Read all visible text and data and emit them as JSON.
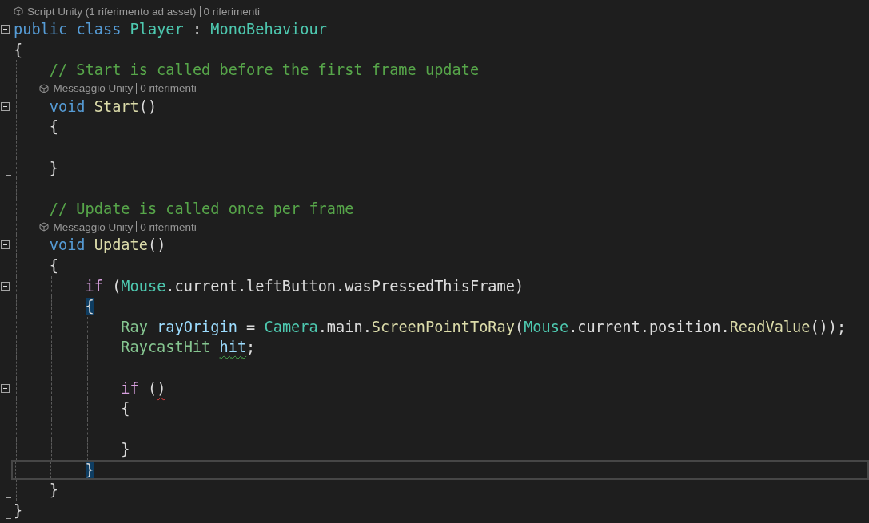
{
  "editor": {
    "lines": [
      {
        "kind": "codelens",
        "items": [
          "Script Unity (1 riferimento ad asset)",
          "0 riferimenti"
        ]
      },
      {
        "kind": "code",
        "expanded": true,
        "tokens": [
          {
            "text": "public",
            "kind": "keyword"
          },
          {
            "text": " class",
            "kind": "keyword"
          },
          {
            "text": " Player",
            "kind": "class"
          },
          {
            "text": " :"
          },
          {
            "text": " MonoBehaviour",
            "kind": "class"
          }
        ]
      },
      {
        "kind": "code",
        "tokens": [
          {
            "text": "{"
          }
        ]
      },
      {
        "kind": "code",
        "tokens": [
          {
            "text": "    // Start is called before the first frame update",
            "kind": "comment"
          }
        ]
      },
      {
        "kind": "codelens",
        "items": [
          "Messaggio Unity",
          "0 riferimenti"
        ]
      },
      {
        "kind": "code",
        "expanded": true,
        "tokens": [
          {
            "text": "    void",
            "kind": "keyword"
          },
          {
            "text": " Start",
            "kind": "method"
          },
          {
            "text": "()"
          }
        ]
      },
      {
        "kind": "code",
        "tokens": [
          {
            "text": "    {"
          }
        ]
      },
      {
        "kind": "code"
      },
      {
        "kind": "code",
        "block_end": true,
        "tokens": [
          {
            "text": "    }"
          }
        ]
      },
      {
        "kind": "code"
      },
      {
        "kind": "code",
        "tokens": [
          {
            "text": "    // Update is called once per frame",
            "kind": "comment"
          }
        ]
      },
      {
        "kind": "codelens",
        "items": [
          "Messaggio Unity",
          "0 riferimenti"
        ]
      },
      {
        "kind": "code",
        "expanded": true,
        "tokens": [
          {
            "text": "    void",
            "kind": "keyword"
          },
          {
            "text": " Update",
            "kind": "method"
          },
          {
            "text": "()"
          }
        ]
      },
      {
        "kind": "code",
        "tokens": [
          {
            "text": "    {"
          }
        ]
      },
      {
        "kind": "code",
        "expanded": true,
        "tokens": [
          {
            "text": "        if",
            "kind": "control"
          },
          {
            "text": " ("
          },
          {
            "text": "Mouse",
            "kind": "class"
          },
          {
            "text": ".current.leftButton.wasPressedThisFrame)"
          }
        ]
      },
      {
        "kind": "code",
        "tokens": [
          {
            "text": "        {",
            "highlighted": true
          }
        ]
      },
      {
        "kind": "code",
        "tokens": [
          {
            "text": "            Ray",
            "kind": "struct"
          },
          {
            "text": " rayOrigin",
            "kind": "variable"
          },
          {
            "text": " ="
          },
          {
            "text": " Camera",
            "kind": "class"
          },
          {
            "text": ".main."
          },
          {
            "text": "ScreenPointToRay",
            "kind": "method"
          },
          {
            "text": "("
          },
          {
            "text": "Mouse",
            "kind": "class"
          },
          {
            "text": ".current.position."
          },
          {
            "text": "ReadValue",
            "kind": "method"
          },
          {
            "text": "());"
          }
        ]
      },
      {
        "kind": "code",
        "tokens": [
          {
            "text": "            RaycastHit",
            "kind": "struct"
          },
          {
            "text": " hit",
            "kind": "variable",
            "warning": true
          },
          {
            "text": ";"
          }
        ]
      },
      {
        "kind": "code"
      },
      {
        "kind": "code",
        "expanded": true,
        "tokens": [
          {
            "text": "            if",
            "kind": "control"
          },
          {
            "text": " ("
          },
          {
            "text": ")",
            "error": true
          }
        ]
      },
      {
        "kind": "code",
        "tokens": [
          {
            "text": "            {"
          }
        ]
      },
      {
        "kind": "code"
      },
      {
        "kind": "code",
        "tokens": [
          {
            "text": "            }"
          }
        ]
      },
      {
        "kind": "code",
        "block_end": true,
        "current": true,
        "tokens": [
          {
            "text": "        }",
            "highlighted": true
          }
        ]
      },
      {
        "kind": "code",
        "block_end": true,
        "tokens": [
          {
            "text": "    }"
          }
        ]
      },
      {
        "kind": "code",
        "block_end": true,
        "tokens": [
          {
            "text": "}"
          }
        ]
      }
    ]
  }
}
